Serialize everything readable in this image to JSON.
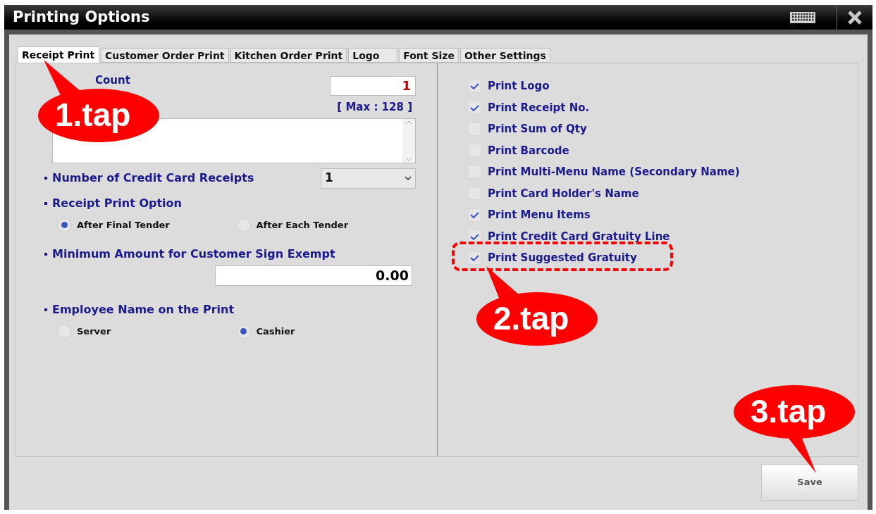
{
  "window": {
    "title": "Printing Options"
  },
  "tabs": [
    {
      "label": "Receipt Print",
      "selected": true
    },
    {
      "label": "Customer Order Print",
      "selected": false
    },
    {
      "label": "Kitchen Order Print",
      "selected": false
    },
    {
      "label": "Logo",
      "selected": false
    },
    {
      "label": "Font Size",
      "selected": false
    },
    {
      "label": "Other Settings",
      "selected": false
    }
  ],
  "receipt_print": {
    "copy_count": {
      "label": "Count",
      "value": "1"
    },
    "message": {
      "max_hint": "[ Max : 128 ]"
    },
    "credit_card_receipts": {
      "label": "Number of Credit Card Receipts",
      "value": "1"
    },
    "receipt_print_option": {
      "label": "Receipt Print Option",
      "options": [
        {
          "label": "After Final Tender",
          "selected": true
        },
        {
          "label": "After Each Tender",
          "selected": false
        }
      ]
    },
    "min_amount": {
      "label": "Minimum Amount for Customer Sign Exempt",
      "value": "0.00"
    },
    "employee_name": {
      "label": "Employee Name on the Print",
      "options": [
        {
          "label": "Server",
          "selected": false
        },
        {
          "label": "Cashier",
          "selected": true
        }
      ]
    }
  },
  "options": [
    {
      "label": "Print Logo",
      "checked": true
    },
    {
      "label": "Print Receipt No.",
      "checked": true
    },
    {
      "label": "Print Sum of Qty",
      "checked": false
    },
    {
      "label": "Print Barcode",
      "checked": false
    },
    {
      "label": "Print Multi-Menu Name (Secondary Name)",
      "checked": false
    },
    {
      "label": "Print Card Holder's Name",
      "checked": false
    },
    {
      "label": "Print Menu Items",
      "checked": true
    },
    {
      "label": "Print Credit Card Gratuity Line",
      "checked": true
    },
    {
      "label": "Print Suggested Gratuity",
      "checked": true
    }
  ],
  "save_button": "Save",
  "callouts": [
    {
      "text": "1.tap"
    },
    {
      "text": "2.tap"
    },
    {
      "text": "3.tap"
    }
  ]
}
